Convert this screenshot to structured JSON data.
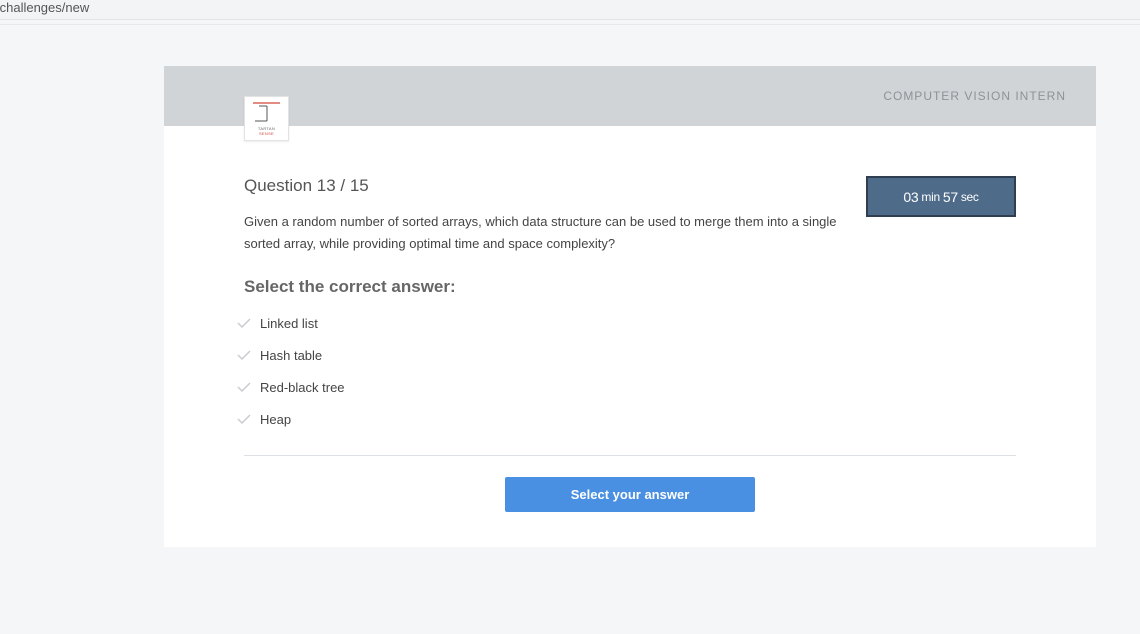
{
  "browser": {
    "url_fragment": "/challenges/new"
  },
  "header": {
    "role_title": "COMPUTER VISION INTERN",
    "logo": {
      "icon": "tartan-sense-logo",
      "line1": "TARTAN",
      "line2": "SENSE",
      "accent_color": "#d0483a"
    }
  },
  "question": {
    "title": "Question 13 / 15",
    "text": "Given a random number of sorted arrays, which data structure can be used to merge them into a single sorted array, while providing optimal time and space complexity?"
  },
  "timer": {
    "minutes": "03",
    "min_unit": "min",
    "seconds": "57",
    "sec_unit": "sec"
  },
  "answers": {
    "prompt": "Select the correct answer:",
    "options": [
      {
        "label": "Linked list",
        "icon": "check-icon"
      },
      {
        "label": "Hash table",
        "icon": "check-icon"
      },
      {
        "label": "Red-black tree",
        "icon": "check-icon"
      },
      {
        "label": "Heap",
        "icon": "check-icon"
      }
    ]
  },
  "submit": {
    "label": "Select your answer"
  },
  "colors": {
    "header_bg": "#d1d4d7",
    "timer_bg": "#4f6b8a",
    "button_bg": "#4a90e2",
    "check_color": "#c8cbd0"
  }
}
